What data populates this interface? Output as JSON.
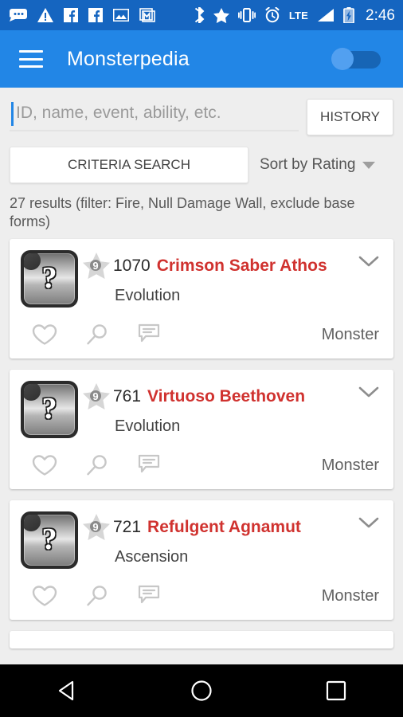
{
  "status_bar": {
    "time": "2:46",
    "network": "LTE",
    "left_icons": [
      "sms-icon",
      "warning-icon",
      "facebook-icon",
      "facebook-icon",
      "photo-icon",
      "gmail-icon"
    ],
    "right_icons": [
      "bluetooth-icon",
      "star-icon",
      "vibrate-icon",
      "alarm-icon",
      "signal-icon",
      "battery-charging-icon"
    ]
  },
  "app_bar": {
    "title": "Monsterpedia",
    "menu_icon": "hamburger-icon",
    "toggle_state": "off"
  },
  "search": {
    "placeholder": "ID, name, event, ability, etc.",
    "value": "",
    "history_label": "HISTORY"
  },
  "criteria": {
    "search_label": "CRITERIA SEARCH",
    "sort_label": "Sort by Rating",
    "sort_icon": "chevron-down-icon"
  },
  "results_text": "27 results (filter: Fire, Null Damage Wall, exclude base forms)",
  "colors": {
    "app_bar": "#2286E6",
    "status_bar": "#1565C0",
    "name_red": "#D0322F",
    "background": "#eeeeee"
  },
  "cards": [
    {
      "thumb_icon": "unknown-monster-placeholder",
      "rarity": "9",
      "id": "1070",
      "name": "Crimson Saber Athos",
      "subtitle": "Evolution",
      "type": "Monster",
      "actions": [
        "favorite-heart-icon",
        "search-magnifier-icon",
        "comment-bubble-icon"
      ],
      "expand_icon": "chevron-down-icon"
    },
    {
      "thumb_icon": "unknown-monster-placeholder",
      "rarity": "9",
      "id": "761",
      "name": "Virtuoso Beethoven",
      "subtitle": "Evolution",
      "type": "Monster",
      "actions": [
        "favorite-heart-icon",
        "search-magnifier-icon",
        "comment-bubble-icon"
      ],
      "expand_icon": "chevron-down-icon"
    },
    {
      "thumb_icon": "unknown-monster-placeholder",
      "rarity": "9",
      "id": "721",
      "name": "Refulgent Agnamut",
      "subtitle": "Ascension",
      "type": "Monster",
      "actions": [
        "favorite-heart-icon",
        "search-magnifier-icon",
        "comment-bubble-icon"
      ],
      "expand_icon": "chevron-down-icon"
    }
  ],
  "nav_bar": {
    "back": "back-triangle-icon",
    "home": "home-circle-icon",
    "recents": "recents-square-icon"
  }
}
